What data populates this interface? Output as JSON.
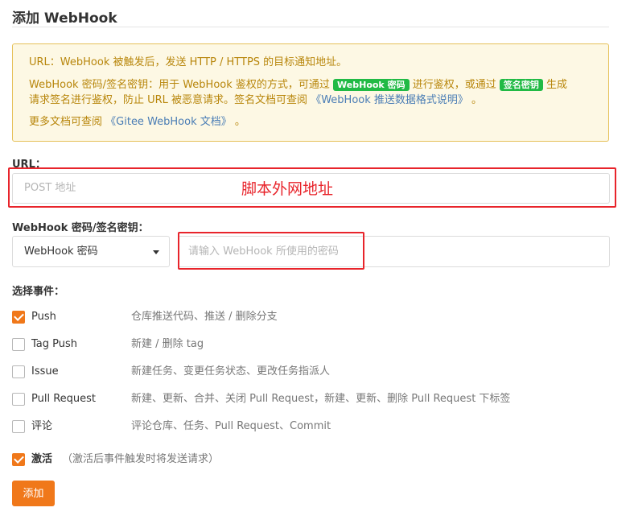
{
  "header": {
    "title": "添加 WebHook"
  },
  "notice": {
    "line1": "URL：WebHook 被触发后，发送 HTTP / HTTPS 的目标通知地址。",
    "line2_pre": "WebHook 密码/签名密钥：用于 WebHook 鉴权的方式，可通过",
    "tag_password": "WebHook 密码",
    "line2_mid": "进行鉴权，或通过",
    "tag_signature": "签名密钥",
    "line2_post": "生成",
    "line3_pre": "请求签名进行鉴权，防止 URL 被恶意请求。签名文档可查阅",
    "line3_link": "《WebHook 推送数据格式说明》",
    "line3_post": "。",
    "line4_pre": "更多文档可查阅",
    "line4_link": "《Gitee WebHook 文档》",
    "line4_post": "。"
  },
  "url_field": {
    "label": "URL：",
    "placeholder": "POST 地址",
    "annotation": "脚本外网地址"
  },
  "secret_field": {
    "label": "WebHook 密码/签名密钥：",
    "selected": "WebHook 密码",
    "placeholder": "请输入 WebHook 所使用的密码"
  },
  "events": {
    "label": "选择事件：",
    "items": [
      {
        "name": "Push",
        "desc": "仓库推送代码、推送 / 删除分支",
        "checked": true
      },
      {
        "name": "Tag Push",
        "desc": "新建 / 删除 tag",
        "checked": false
      },
      {
        "name": "Issue",
        "desc": "新建任务、变更任务状态、更改任务指派人",
        "checked": false
      },
      {
        "name": "Pull Request",
        "desc": "新建、更新、合并、关闭 Pull Request，新建、更新、删除 Pull Request 下标签",
        "checked": false
      },
      {
        "name": "评论",
        "desc": "评论仓库、任务、Pull Request、Commit",
        "checked": false
      }
    ]
  },
  "activate": {
    "label": "激活",
    "hint": "（激活后事件触发时将发送请求）",
    "checked": true
  },
  "actions": {
    "add_label": "添加"
  },
  "colors": {
    "accent": "#f0781a",
    "annotation_red": "#e8242b",
    "tag_green": "#21ba45",
    "notice_bg": "#fdf8e4"
  }
}
